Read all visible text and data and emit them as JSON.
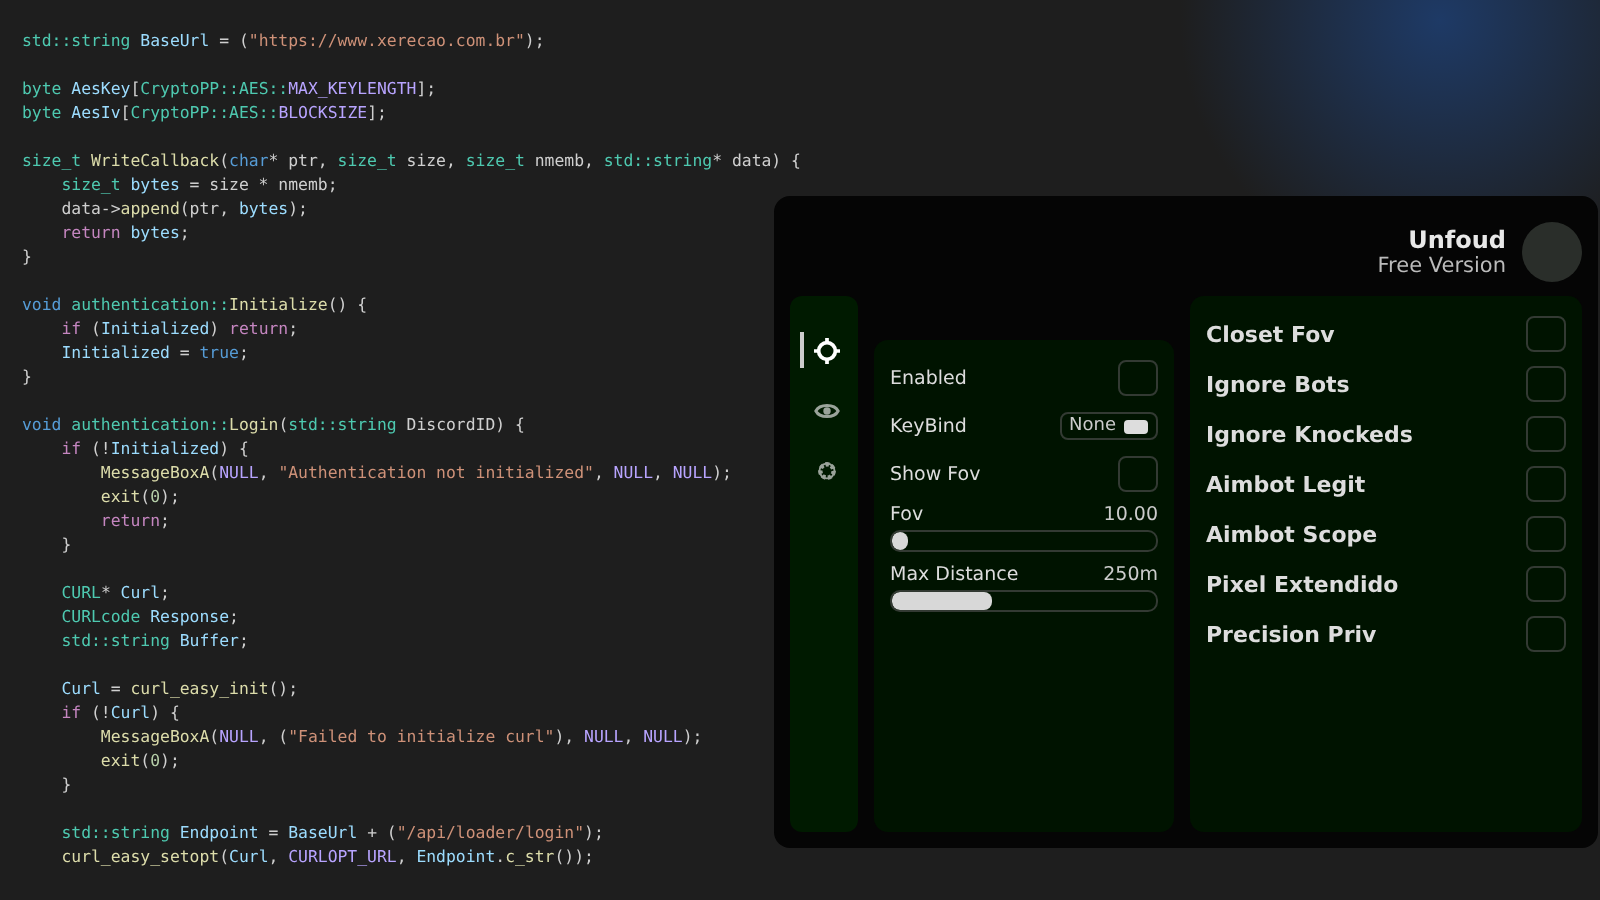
{
  "editor": {
    "blocks": [
      {
        "lines": [
          [
            {
              "kind": "type",
              "text": "std::string"
            },
            {
              "kind": "var",
              "text": " BaseUrl"
            },
            {
              "kind": "plain",
              "text": " = ("
            },
            {
              "kind": "string",
              "text": "\"https://www.xerecao.com.br\""
            },
            {
              "kind": "plain",
              "text": ");"
            }
          ]
        ]
      },
      {
        "lines": [
          [
            {
              "kind": "type",
              "text": "byte"
            },
            {
              "kind": "var",
              "text": " AesKey"
            },
            {
              "kind": "plain",
              "text": "["
            },
            {
              "kind": "type",
              "text": "CryptoPP::AES::"
            },
            {
              "kind": "macro",
              "text": "MAX_KEYLENGTH"
            },
            {
              "kind": "plain",
              "text": "];"
            }
          ],
          [
            {
              "kind": "type",
              "text": "byte"
            },
            {
              "kind": "var",
              "text": " AesIv"
            },
            {
              "kind": "plain",
              "text": "["
            },
            {
              "kind": "type",
              "text": "CryptoPP::AES::"
            },
            {
              "kind": "macro",
              "text": "BLOCKSIZE"
            },
            {
              "kind": "plain",
              "text": "];"
            }
          ]
        ]
      },
      {
        "lines": [
          [
            {
              "kind": "type",
              "text": "size_t"
            },
            {
              "kind": "func",
              "text": " WriteCallback"
            },
            {
              "kind": "plain",
              "text": "("
            },
            {
              "kind": "keyword",
              "text": "char"
            },
            {
              "kind": "plain",
              "text": "* ptr, "
            },
            {
              "kind": "type",
              "text": "size_t"
            },
            {
              "kind": "plain",
              "text": " size, "
            },
            {
              "kind": "type",
              "text": "size_t"
            },
            {
              "kind": "plain",
              "text": " nmemb, "
            },
            {
              "kind": "type",
              "text": "std::string"
            },
            {
              "kind": "plain",
              "text": "* data) {"
            }
          ],
          [
            {
              "kind": "type",
              "text": "    size_t"
            },
            {
              "kind": "var",
              "text": " bytes"
            },
            {
              "kind": "plain",
              "text": " = size * nmemb;"
            }
          ],
          [
            {
              "kind": "plain",
              "text": "    data->"
            },
            {
              "kind": "func",
              "text": "append"
            },
            {
              "kind": "plain",
              "text": "(ptr, "
            },
            {
              "kind": "var",
              "text": "bytes"
            },
            {
              "kind": "plain",
              "text": ");"
            }
          ],
          [
            {
              "kind": "control",
              "text": "    return"
            },
            {
              "kind": "var",
              "text": " bytes"
            },
            {
              "kind": "plain",
              "text": ";"
            }
          ],
          [
            {
              "kind": "plain",
              "text": "}"
            }
          ]
        ]
      },
      {
        "lines": [
          [
            {
              "kind": "keyword",
              "text": "void"
            },
            {
              "kind": "type",
              "text": " authentication::"
            },
            {
              "kind": "func",
              "text": "Initialize"
            },
            {
              "kind": "plain",
              "text": "() {"
            }
          ],
          [
            {
              "kind": "control",
              "text": "    if"
            },
            {
              "kind": "plain",
              "text": " ("
            },
            {
              "kind": "var",
              "text": "Initialized"
            },
            {
              "kind": "plain",
              "text": ") "
            },
            {
              "kind": "control",
              "text": "return"
            },
            {
              "kind": "plain",
              "text": ";"
            }
          ],
          [
            {
              "kind": "var",
              "text": "    Initialized"
            },
            {
              "kind": "plain",
              "text": " = "
            },
            {
              "kind": "keyword",
              "text": "true"
            },
            {
              "kind": "plain",
              "text": ";"
            }
          ],
          [
            {
              "kind": "plain",
              "text": "}"
            }
          ]
        ]
      },
      {
        "lines": [
          [
            {
              "kind": "keyword",
              "text": "void"
            },
            {
              "kind": "type",
              "text": " authentication::"
            },
            {
              "kind": "func",
              "text": "Login"
            },
            {
              "kind": "plain",
              "text": "("
            },
            {
              "kind": "type",
              "text": "std::string"
            },
            {
              "kind": "plain",
              "text": " DiscordID) {"
            }
          ],
          [
            {
              "kind": "control",
              "text": "    if"
            },
            {
              "kind": "plain",
              "text": " (!"
            },
            {
              "kind": "var",
              "text": "Initialized"
            },
            {
              "kind": "plain",
              "text": ") {"
            }
          ],
          [
            {
              "kind": "func",
              "text": "        MessageBoxA"
            },
            {
              "kind": "plain",
              "text": "("
            },
            {
              "kind": "macro",
              "text": "NULL"
            },
            {
              "kind": "plain",
              "text": ", "
            },
            {
              "kind": "string",
              "text": "\"Authentication not initialized\""
            },
            {
              "kind": "plain",
              "text": ", "
            },
            {
              "kind": "macro",
              "text": "NULL"
            },
            {
              "kind": "plain",
              "text": ", "
            },
            {
              "kind": "macro",
              "text": "NULL"
            },
            {
              "kind": "plain",
              "text": ");"
            }
          ],
          [
            {
              "kind": "func",
              "text": "        exit"
            },
            {
              "kind": "plain",
              "text": "("
            },
            {
              "kind": "number",
              "text": "0"
            },
            {
              "kind": "plain",
              "text": ");"
            }
          ],
          [
            {
              "kind": "control",
              "text": "        return"
            },
            {
              "kind": "plain",
              "text": ";"
            }
          ],
          [
            {
              "kind": "plain",
              "text": "    }"
            }
          ]
        ]
      },
      {
        "lines": [
          [
            {
              "kind": "type",
              "text": "    CURL"
            },
            {
              "kind": "plain",
              "text": "* "
            },
            {
              "kind": "var",
              "text": "Curl"
            },
            {
              "kind": "plain",
              "text": ";"
            }
          ],
          [
            {
              "kind": "type",
              "text": "    CURLcode"
            },
            {
              "kind": "var",
              "text": " Response"
            },
            {
              "kind": "plain",
              "text": ";"
            }
          ],
          [
            {
              "kind": "type",
              "text": "    std::string"
            },
            {
              "kind": "var",
              "text": " Buffer"
            },
            {
              "kind": "plain",
              "text": ";"
            }
          ]
        ]
      },
      {
        "lines": [
          [
            {
              "kind": "var",
              "text": "    Curl"
            },
            {
              "kind": "plain",
              "text": " = "
            },
            {
              "kind": "func",
              "text": "curl_easy_init"
            },
            {
              "kind": "plain",
              "text": "();"
            }
          ],
          [
            {
              "kind": "control",
              "text": "    if"
            },
            {
              "kind": "plain",
              "text": " (!"
            },
            {
              "kind": "var",
              "text": "Curl"
            },
            {
              "kind": "plain",
              "text": ") {"
            }
          ],
          [
            {
              "kind": "func",
              "text": "        MessageBoxA"
            },
            {
              "kind": "plain",
              "text": "("
            },
            {
              "kind": "macro",
              "text": "NULL"
            },
            {
              "kind": "plain",
              "text": ", ("
            },
            {
              "kind": "string",
              "text": "\"Failed to initialize curl\""
            },
            {
              "kind": "plain",
              "text": "), "
            },
            {
              "kind": "macro",
              "text": "NULL"
            },
            {
              "kind": "plain",
              "text": ", "
            },
            {
              "kind": "macro",
              "text": "NULL"
            },
            {
              "kind": "plain",
              "text": ");"
            }
          ],
          [
            {
              "kind": "func",
              "text": "        exit"
            },
            {
              "kind": "plain",
              "text": "("
            },
            {
              "kind": "number",
              "text": "0"
            },
            {
              "kind": "plain",
              "text": ");"
            }
          ],
          [
            {
              "kind": "plain",
              "text": "    }"
            }
          ]
        ]
      },
      {
        "lines": [
          [
            {
              "kind": "type",
              "text": "    std::string"
            },
            {
              "kind": "var",
              "text": " Endpoint"
            },
            {
              "kind": "plain",
              "text": " = "
            },
            {
              "kind": "var",
              "text": "BaseUrl"
            },
            {
              "kind": "plain",
              "text": " + ("
            },
            {
              "kind": "string",
              "text": "\"/api/loader/login\""
            },
            {
              "kind": "plain",
              "text": ");"
            }
          ],
          [
            {
              "kind": "func",
              "text": "    curl_easy_setopt"
            },
            {
              "kind": "plain",
              "text": "("
            },
            {
              "kind": "var",
              "text": "Curl"
            },
            {
              "kind": "plain",
              "text": ", "
            },
            {
              "kind": "macro",
              "text": "CURLOPT_URL"
            },
            {
              "kind": "plain",
              "text": ", "
            },
            {
              "kind": "var",
              "text": "Endpoint"
            },
            {
              "kind": "plain",
              "text": "."
            },
            {
              "kind": "func",
              "text": "c_str"
            },
            {
              "kind": "plain",
              "text": "());"
            }
          ]
        ]
      }
    ]
  },
  "menu": {
    "title": "Unfoud",
    "subtitle": "Free Version",
    "sidebar": {
      "tabs": [
        {
          "kind": "target",
          "selected": true
        },
        {
          "kind": "eye",
          "selected": false
        },
        {
          "kind": "gear",
          "selected": false
        }
      ]
    },
    "left_panel": [
      {
        "kind": "checkbox",
        "label": "Enabled",
        "checked": false
      },
      {
        "kind": "keybind",
        "label": "KeyBind",
        "value": "None"
      },
      {
        "kind": "checkbox",
        "label": "Show Fov",
        "checked": false
      },
      {
        "kind": "slider",
        "label": "Fov",
        "reading": "10.00",
        "level": 0.05
      },
      {
        "kind": "slider",
        "label": "Max Distance",
        "reading": "250m",
        "level": 0.38
      }
    ],
    "right_panel": [
      {
        "label": "Closet Fov",
        "checked": false
      },
      {
        "label": "Ignore Bots",
        "checked": false
      },
      {
        "label": "Ignore Knockeds",
        "checked": false
      },
      {
        "label": "Aimbot Legit",
        "checked": false
      },
      {
        "label": "Aimbot Scope",
        "checked": false
      },
      {
        "label": "Pixel Extendido",
        "checked": false
      },
      {
        "label": "Precision Priv",
        "checked": false
      }
    ]
  }
}
